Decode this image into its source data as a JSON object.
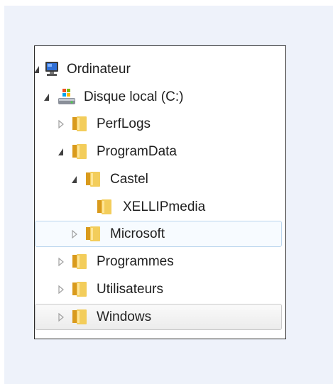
{
  "tree": {
    "items": [
      {
        "label": "Ordinateur",
        "icon": "computer-icon",
        "expanded": true,
        "level": 0
      },
      {
        "label": "Disque local (C:)",
        "icon": "drive-icon",
        "expanded": true,
        "level": 0
      },
      {
        "label": "PerfLogs",
        "icon": "folder-icon",
        "expanded": false,
        "level": 1
      },
      {
        "label": "ProgramData",
        "icon": "folder-icon",
        "expanded": true,
        "level": 1
      },
      {
        "label": "Castel",
        "icon": "folder-icon",
        "expanded": true,
        "level": 2
      },
      {
        "label": "XELLIPmedia",
        "icon": "folder-icon",
        "expanded": false,
        "level": 3
      },
      {
        "label": "Microsoft",
        "icon": "folder-icon",
        "expanded": false,
        "level": 2,
        "state": "hover"
      },
      {
        "label": "Programmes",
        "icon": "folder-icon",
        "expanded": false,
        "level": 1
      },
      {
        "label": "Utilisateurs",
        "icon": "folder-icon",
        "expanded": false,
        "level": 1
      },
      {
        "label": "Windows",
        "icon": "folder-icon",
        "expanded": false,
        "level": 1,
        "state": "selected"
      }
    ]
  },
  "colors": {
    "backdrop": "#eef2fa",
    "folder": "#e8b53a",
    "hover_border": "#bcd6ee",
    "selected_border": "#c9c9c9",
    "text": "#1e1e1e"
  }
}
